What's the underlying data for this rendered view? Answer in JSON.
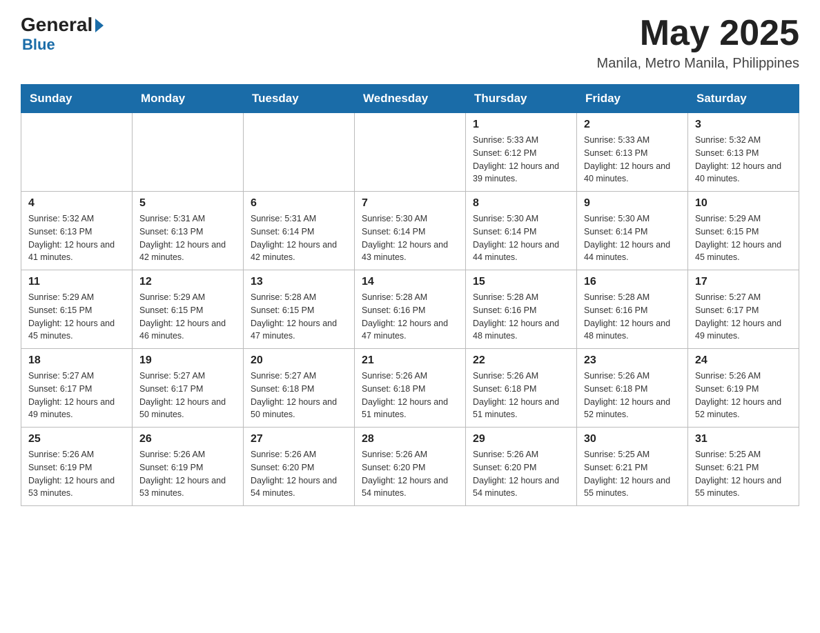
{
  "header": {
    "logo_general": "General",
    "logo_blue": "Blue",
    "month_title": "May 2025",
    "location": "Manila, Metro Manila, Philippines"
  },
  "days_of_week": [
    "Sunday",
    "Monday",
    "Tuesday",
    "Wednesday",
    "Thursday",
    "Friday",
    "Saturday"
  ],
  "weeks": [
    [
      {
        "day": "",
        "sunrise": "",
        "sunset": "",
        "daylight": ""
      },
      {
        "day": "",
        "sunrise": "",
        "sunset": "",
        "daylight": ""
      },
      {
        "day": "",
        "sunrise": "",
        "sunset": "",
        "daylight": ""
      },
      {
        "day": "",
        "sunrise": "",
        "sunset": "",
        "daylight": ""
      },
      {
        "day": "1",
        "sunrise": "Sunrise: 5:33 AM",
        "sunset": "Sunset: 6:12 PM",
        "daylight": "Daylight: 12 hours and 39 minutes."
      },
      {
        "day": "2",
        "sunrise": "Sunrise: 5:33 AM",
        "sunset": "Sunset: 6:13 PM",
        "daylight": "Daylight: 12 hours and 40 minutes."
      },
      {
        "day": "3",
        "sunrise": "Sunrise: 5:32 AM",
        "sunset": "Sunset: 6:13 PM",
        "daylight": "Daylight: 12 hours and 40 minutes."
      }
    ],
    [
      {
        "day": "4",
        "sunrise": "Sunrise: 5:32 AM",
        "sunset": "Sunset: 6:13 PM",
        "daylight": "Daylight: 12 hours and 41 minutes."
      },
      {
        "day": "5",
        "sunrise": "Sunrise: 5:31 AM",
        "sunset": "Sunset: 6:13 PM",
        "daylight": "Daylight: 12 hours and 42 minutes."
      },
      {
        "day": "6",
        "sunrise": "Sunrise: 5:31 AM",
        "sunset": "Sunset: 6:14 PM",
        "daylight": "Daylight: 12 hours and 42 minutes."
      },
      {
        "day": "7",
        "sunrise": "Sunrise: 5:30 AM",
        "sunset": "Sunset: 6:14 PM",
        "daylight": "Daylight: 12 hours and 43 minutes."
      },
      {
        "day": "8",
        "sunrise": "Sunrise: 5:30 AM",
        "sunset": "Sunset: 6:14 PM",
        "daylight": "Daylight: 12 hours and 44 minutes."
      },
      {
        "day": "9",
        "sunrise": "Sunrise: 5:30 AM",
        "sunset": "Sunset: 6:14 PM",
        "daylight": "Daylight: 12 hours and 44 minutes."
      },
      {
        "day": "10",
        "sunrise": "Sunrise: 5:29 AM",
        "sunset": "Sunset: 6:15 PM",
        "daylight": "Daylight: 12 hours and 45 minutes."
      }
    ],
    [
      {
        "day": "11",
        "sunrise": "Sunrise: 5:29 AM",
        "sunset": "Sunset: 6:15 PM",
        "daylight": "Daylight: 12 hours and 45 minutes."
      },
      {
        "day": "12",
        "sunrise": "Sunrise: 5:29 AM",
        "sunset": "Sunset: 6:15 PM",
        "daylight": "Daylight: 12 hours and 46 minutes."
      },
      {
        "day": "13",
        "sunrise": "Sunrise: 5:28 AM",
        "sunset": "Sunset: 6:15 PM",
        "daylight": "Daylight: 12 hours and 47 minutes."
      },
      {
        "day": "14",
        "sunrise": "Sunrise: 5:28 AM",
        "sunset": "Sunset: 6:16 PM",
        "daylight": "Daylight: 12 hours and 47 minutes."
      },
      {
        "day": "15",
        "sunrise": "Sunrise: 5:28 AM",
        "sunset": "Sunset: 6:16 PM",
        "daylight": "Daylight: 12 hours and 48 minutes."
      },
      {
        "day": "16",
        "sunrise": "Sunrise: 5:28 AM",
        "sunset": "Sunset: 6:16 PM",
        "daylight": "Daylight: 12 hours and 48 minutes."
      },
      {
        "day": "17",
        "sunrise": "Sunrise: 5:27 AM",
        "sunset": "Sunset: 6:17 PM",
        "daylight": "Daylight: 12 hours and 49 minutes."
      }
    ],
    [
      {
        "day": "18",
        "sunrise": "Sunrise: 5:27 AM",
        "sunset": "Sunset: 6:17 PM",
        "daylight": "Daylight: 12 hours and 49 minutes."
      },
      {
        "day": "19",
        "sunrise": "Sunrise: 5:27 AM",
        "sunset": "Sunset: 6:17 PM",
        "daylight": "Daylight: 12 hours and 50 minutes."
      },
      {
        "day": "20",
        "sunrise": "Sunrise: 5:27 AM",
        "sunset": "Sunset: 6:18 PM",
        "daylight": "Daylight: 12 hours and 50 minutes."
      },
      {
        "day": "21",
        "sunrise": "Sunrise: 5:26 AM",
        "sunset": "Sunset: 6:18 PM",
        "daylight": "Daylight: 12 hours and 51 minutes."
      },
      {
        "day": "22",
        "sunrise": "Sunrise: 5:26 AM",
        "sunset": "Sunset: 6:18 PM",
        "daylight": "Daylight: 12 hours and 51 minutes."
      },
      {
        "day": "23",
        "sunrise": "Sunrise: 5:26 AM",
        "sunset": "Sunset: 6:18 PM",
        "daylight": "Daylight: 12 hours and 52 minutes."
      },
      {
        "day": "24",
        "sunrise": "Sunrise: 5:26 AM",
        "sunset": "Sunset: 6:19 PM",
        "daylight": "Daylight: 12 hours and 52 minutes."
      }
    ],
    [
      {
        "day": "25",
        "sunrise": "Sunrise: 5:26 AM",
        "sunset": "Sunset: 6:19 PM",
        "daylight": "Daylight: 12 hours and 53 minutes."
      },
      {
        "day": "26",
        "sunrise": "Sunrise: 5:26 AM",
        "sunset": "Sunset: 6:19 PM",
        "daylight": "Daylight: 12 hours and 53 minutes."
      },
      {
        "day": "27",
        "sunrise": "Sunrise: 5:26 AM",
        "sunset": "Sunset: 6:20 PM",
        "daylight": "Daylight: 12 hours and 54 minutes."
      },
      {
        "day": "28",
        "sunrise": "Sunrise: 5:26 AM",
        "sunset": "Sunset: 6:20 PM",
        "daylight": "Daylight: 12 hours and 54 minutes."
      },
      {
        "day": "29",
        "sunrise": "Sunrise: 5:26 AM",
        "sunset": "Sunset: 6:20 PM",
        "daylight": "Daylight: 12 hours and 54 minutes."
      },
      {
        "day": "30",
        "sunrise": "Sunrise: 5:25 AM",
        "sunset": "Sunset: 6:21 PM",
        "daylight": "Daylight: 12 hours and 55 minutes."
      },
      {
        "day": "31",
        "sunrise": "Sunrise: 5:25 AM",
        "sunset": "Sunset: 6:21 PM",
        "daylight": "Daylight: 12 hours and 55 minutes."
      }
    ]
  ]
}
